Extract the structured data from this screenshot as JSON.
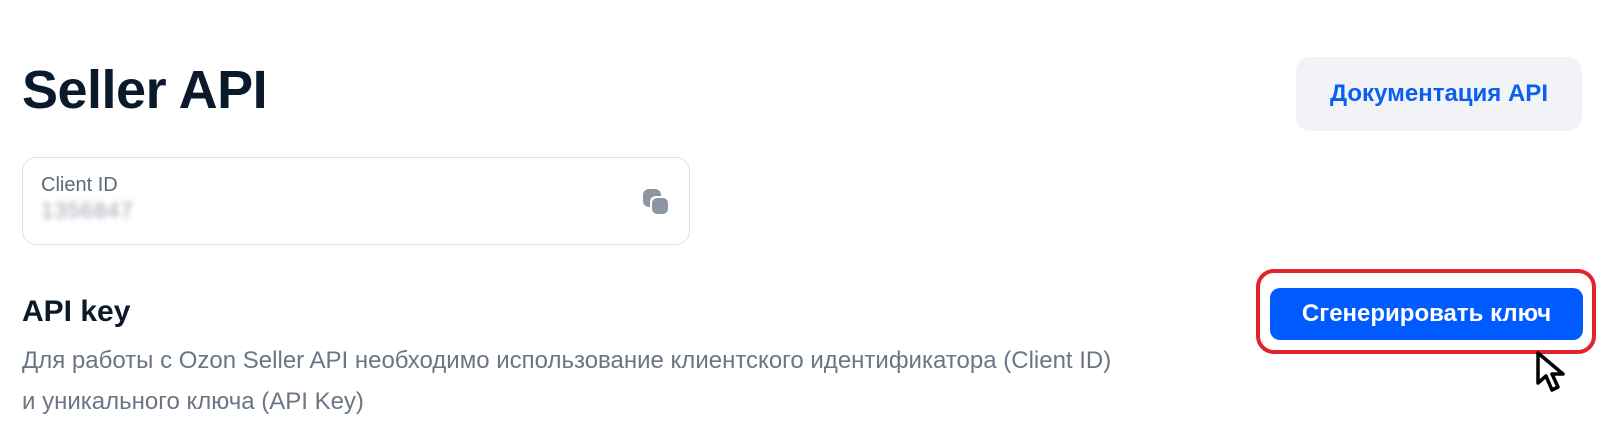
{
  "header": {
    "title": "Seller API",
    "docs_button_label": "Документация API"
  },
  "client_id_card": {
    "label": "Client ID",
    "value": "1356847",
    "copy_icon": "copy-icon"
  },
  "api_key_section": {
    "title": "API key",
    "description": "Для работы с Ozon Seller API необходимо использование клиентского идентификатора (Client ID) и уникального ключа (API Key)",
    "generate_button_label": "Сгенерировать ключ"
  },
  "colors": {
    "accent": "#005bff",
    "link": "#0a5ff0",
    "highlight": "#e4222a",
    "text_primary": "#0b1a2b",
    "text_secondary": "#6b7684"
  }
}
